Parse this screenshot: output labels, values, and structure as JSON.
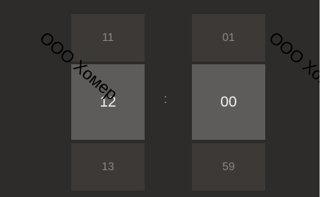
{
  "time_picker": {
    "hours": {
      "previous": "11",
      "selected": "12",
      "next": "13"
    },
    "separator": ":",
    "minutes": {
      "previous": "01",
      "selected": "00",
      "next": "59"
    }
  },
  "watermark": {
    "text_left": "ООО Хомер",
    "text_right": "ООО Хомер"
  }
}
